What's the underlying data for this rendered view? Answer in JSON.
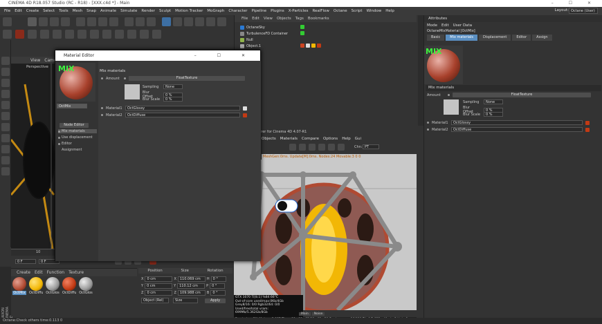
{
  "window": {
    "title": "CINEMA 4D R18.057 Studio (RC - R18) - [XXX.c4d *] - Main",
    "controls": "–  ☐  ✕"
  },
  "menu": [
    "File",
    "Edit",
    "Create",
    "Select",
    "Tools",
    "Mesh",
    "Snap",
    "Animate",
    "Simulate",
    "Render",
    "Sculpt",
    "Motion Tracker",
    "MoGraph",
    "Character",
    "Pipeline",
    "Plugins",
    "X-Particles",
    "RealFlow",
    "Octane",
    "Script",
    "Window",
    "Help"
  ],
  "layout": {
    "label": "Layout:",
    "value": "Octane (User)"
  },
  "viewport": {
    "menu": [
      "View",
      "Came"
    ],
    "name": "Perspective"
  },
  "timeline": {
    "start": "0 F",
    "mark": "10",
    "current": "0 F"
  },
  "material_manager": {
    "menu": [
      "Create",
      "Edit",
      "Function",
      "Texture"
    ],
    "materials": [
      {
        "name": "OctMix",
        "color": "#b04a32"
      },
      {
        "name": "OctDiffu",
        "color": "#f2b705"
      },
      {
        "name": "OctGlos",
        "color": "#9a9a9a"
      },
      {
        "name": "OctDiffu",
        "color": "#c23a14"
      },
      {
        "name": "OctGlos",
        "color": "#9a9a9a"
      }
    ]
  },
  "coordinates": {
    "headers": [
      "Position",
      "Size",
      "Rotation"
    ],
    "rows": [
      {
        "axis": "X",
        "pos": "0 cm",
        "size_axis": "X",
        "size": "110.069 cm",
        "rot_axis": "H",
        "rot": "0 °"
      },
      {
        "axis": "Y",
        "pos": "0 cm",
        "size_axis": "Y",
        "size": "110.12 cm",
        "rot_axis": "P",
        "rot": "0 °"
      },
      {
        "axis": "Z",
        "pos": "0 cm",
        "size_axis": "Z",
        "size": "109.988 cm",
        "rot_axis": "B",
        "rot": "0 °"
      }
    ],
    "mode": "Object (Rel)",
    "size_mode": "Size",
    "apply": "Apply"
  },
  "object_manager": {
    "menu": [
      "File",
      "Edit",
      "View",
      "Objects",
      "Tags",
      "Bookmarks"
    ],
    "objects": [
      "OctaneSky",
      "TurbulenceFD Container",
      "Null",
      "Object.1"
    ]
  },
  "render": {
    "title": "Octane Renderer for Cinema 4D 4.07-R1",
    "menu": [
      "Objects",
      "Materials",
      "Compare",
      "Options",
      "Help",
      "Gui"
    ],
    "channel_label": "Chn:",
    "channel": "PT",
    "stats": "MeshGen:0ms. Update[M]:0ms. Nodes:24 Movable:3  0 0",
    "info": [
      "GTX 1070 Ti[8.1]   %84   66°C",
      "Out-of-core used/max:0Kb/4Gb",
      "Grey8/16: 0/0        Rgb32/64: 0/0",
      "Used/free/total vram: 699Mb/5.362Gb/8Gb"
    ],
    "status": "Rendering: 2%  Ms/sec: 3.067   Time: 00 : 00 : 02/00 : 01 : 20   Spp/maxspp: 16/800   Tri: 0/2.833m   Mesh: 3   Hair: 0",
    "tabs": [
      "Main",
      "Noise"
    ]
  },
  "attributes": {
    "title": "Attributes",
    "menu": [
      "Mode",
      "Edit",
      "User Data"
    ],
    "object": "OctaneMixMaterial [OctMix]",
    "tabs": [
      "Basic",
      "Mix materials",
      "Displacement",
      "Editor",
      "Assign"
    ],
    "active_tab": "Mix materials",
    "section": "Mix materials",
    "amount_label": "Amount",
    "amount_texture": "FloatTexture",
    "sampling_label": "Sampling",
    "sampling_value": "None",
    "blur_offset_label": "Blur Offset",
    "blur_offset": "0 %",
    "blur_scale_label": "Blur Scale",
    "blur_scale": "0 %",
    "material1_label": "Material1",
    "material1": "OctGlossy",
    "material2_label": "Material2",
    "material2": "OctDiffuse",
    "preview_badge": "MIX"
  },
  "material_editor": {
    "title": "Material Editor",
    "controls": "–  ☐  ✕",
    "name": "OctMix",
    "node_editor": "Node Editor",
    "channels": [
      {
        "label": "Mix materials",
        "checked": true,
        "selected": true
      },
      {
        "label": "Use displacement",
        "checked": true,
        "selected": false
      },
      {
        "label": "Editor",
        "checked": false,
        "selected": false
      },
      {
        "label": "Assignment",
        "checked": false,
        "selected": false
      }
    ],
    "section": "Mix materials",
    "amount_label": "Amount",
    "amount_texture": "FloatTexture",
    "sampling_label": "Sampling",
    "sampling_value": "None",
    "blur_offset_label": "Blur Offset",
    "blur_offset": "0 %",
    "blur_scale_label": "Blur Scale",
    "blur_scale": "0 %",
    "material1_label": "Material1",
    "material1": "OctGlossy",
    "material2_label": "Material2",
    "material2": "OctDiffuse",
    "preview_badge": "MIX"
  },
  "statusbar": "Octane:Check others time:0.113  0",
  "sidebar_brand": "MAXON CINEMA 4D",
  "colors": {
    "accent": "#5a8fc2",
    "mix_badge": "#3ef33e",
    "render_bg": "#c9c9c9",
    "cage": "#c2461b"
  }
}
